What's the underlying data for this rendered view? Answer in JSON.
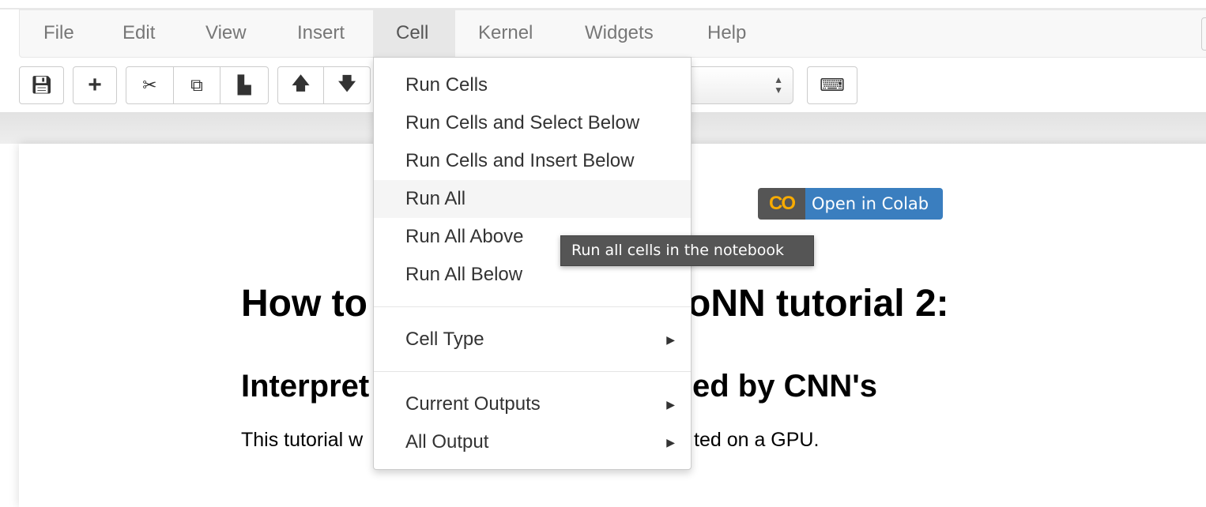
{
  "menubar": {
    "items": [
      {
        "label": "File"
      },
      {
        "label": "Edit"
      },
      {
        "label": "View"
      },
      {
        "label": "Insert"
      },
      {
        "label": "Cell",
        "active": true
      },
      {
        "label": "Kernel"
      },
      {
        "label": "Widgets"
      },
      {
        "label": "Help"
      }
    ]
  },
  "toolbar": {
    "icons": [
      "save-icon",
      "plus-icon",
      "scissors-icon",
      "copy-icon",
      "paste-icon",
      "arrow-up-icon",
      "arrow-down-icon",
      "keyboard-icon"
    ]
  },
  "cell_menu": {
    "items": [
      {
        "label": "Run Cells"
      },
      {
        "label": "Run Cells and Select Below"
      },
      {
        "label": "Run Cells and Insert Below"
      },
      {
        "label": "Run All",
        "highlighted": true
      },
      {
        "label": "Run All Above"
      },
      {
        "label": "Run All Below"
      },
      {
        "label": "Cell Type",
        "submenu": true
      },
      {
        "label": "Current Outputs",
        "submenu": true
      },
      {
        "label": "All Output",
        "submenu": true
      }
    ]
  },
  "tooltip": "Run all cells in the notebook",
  "colab_badge": {
    "logo": "CO",
    "label": "Open in Colab",
    "colors": {
      "logo_bg": "#555555",
      "label_bg": "#3a7ebf",
      "logo": "#f9ab00"
    }
  },
  "notebook": {
    "h1_left": "How to",
    "h1_right": "oNN tutorial 2:",
    "h2_left": "Interpret",
    "h2_right": "ed by CNN's",
    "p_left": "This tutorial w",
    "p_right": "ted on a GPU."
  }
}
